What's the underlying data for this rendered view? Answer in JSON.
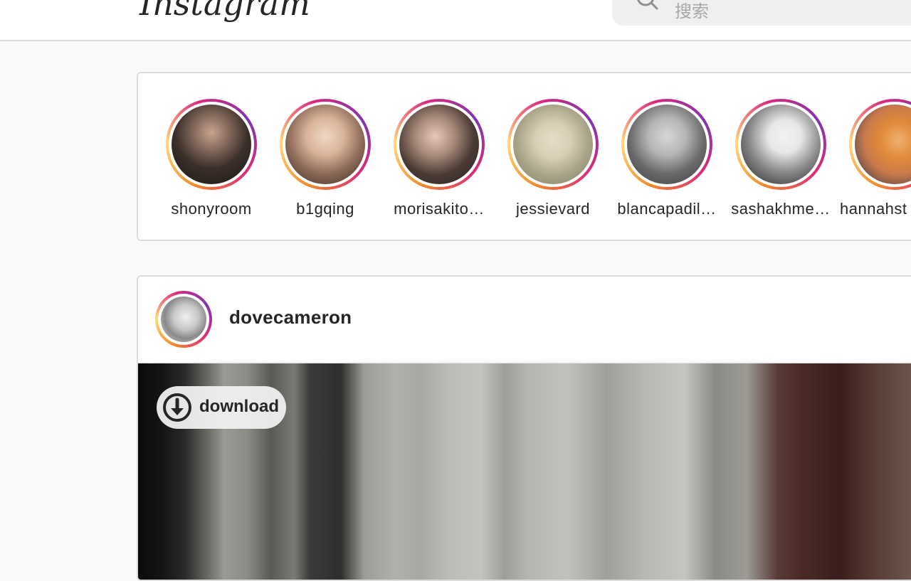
{
  "header": {
    "logo_text": "Instagram",
    "search": {
      "placeholder": "搜索"
    }
  },
  "stories": [
    {
      "username": "shonyroom",
      "avatar_colors": [
        "#3b2f2a",
        "#c9a48e",
        "#1b1714"
      ]
    },
    {
      "username": "b1gqing",
      "avatar_colors": [
        "#d9b49a",
        "#8c6a58",
        "#f0d8c6"
      ]
    },
    {
      "username": "morisakitomomi",
      "display": "morisakito…",
      "avatar_colors": [
        "#2a2220",
        "#e6c9b8",
        "#4a3a34"
      ]
    },
    {
      "username": "jessievard",
      "display": "jessievard",
      "avatar_colors": [
        "#a9a489",
        "#d8cfb5",
        "#7e7a5e"
      ]
    },
    {
      "username": "blancapadilla",
      "display": "blancapadil…",
      "avatar_colors": [
        "#3c3c3c",
        "#b6b6b6",
        "#6a6a6a"
      ]
    },
    {
      "username": "sashakhmelevskaya",
      "display": "sashakhme…",
      "avatar_colors": [
        "#1a1a1a",
        "#e8e8e8",
        "#8a8a8a"
      ]
    },
    {
      "username": "hannahstocking",
      "display": "hannahst",
      "avatar_colors": [
        "#e08a3a",
        "#1c2a4a",
        "#c97a4a"
      ]
    }
  ],
  "post": {
    "username": "dovecameron",
    "download_label": "download"
  },
  "colors": {
    "ring_start": "#f58529",
    "ring_mid": "#dd2a7b",
    "ring_end": "#8134af",
    "border": "#dbdbdb",
    "background": "#fafafa"
  }
}
